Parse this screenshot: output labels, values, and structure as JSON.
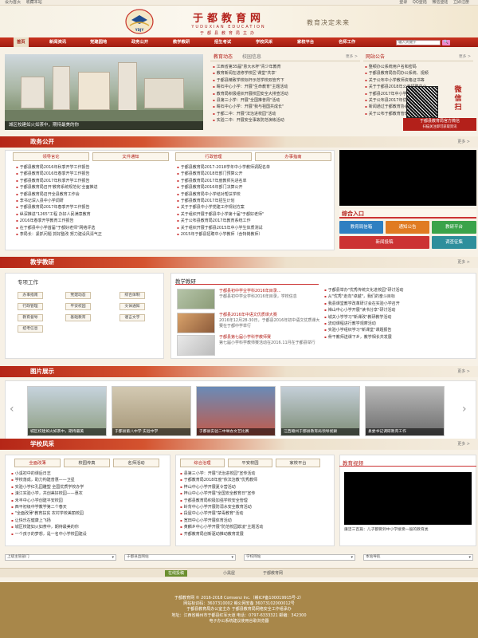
{
  "topbar": {
    "left": [
      "设为首页",
      "收藏本站"
    ],
    "right": [
      "登录",
      "QQ登陆",
      "微信登陆",
      "立即注册"
    ]
  },
  "header": {
    "brand": "于都教育网",
    "brand_en": "YUDUXIAN EDUCATION",
    "brand_sub": "于都县教育局主办",
    "logo_text": "YDJY",
    "slogan": "教育决定未来"
  },
  "nav": {
    "items": [
      "首页",
      "新闻资讯",
      "党建园地",
      "政务公开",
      "教学教研",
      "招生考试",
      "学校风采",
      "家校平台",
      "名师工作"
    ],
    "search_placeholder": "输入关键字",
    "search_btn": "🔍"
  },
  "banner": {
    "caption": "城区校建如火如荼中，期待最美的你"
  },
  "news": {
    "tabs": [
      "教育动态",
      "校园信息"
    ],
    "more": "更多 >",
    "items": [
      "江西省第35届\"意大水杯\"青少年教育",
      "教育新闻在进修学校区'课堂\"共享'",
      "于都县精致学校标杆示范学校双管齐下",
      "睛石中心小学：开展\"生命教育\"主题活动",
      "教育局积极组织开展校园安全大排查活动",
      "县第三小学：开展\"全国推普周\"活动",
      "睛石中心小学：开展\"我与祖国共成长\"",
      "于都二中：开展\"法治进校园\"活动",
      "实验二中：开展安全事故防范演练活动"
    ]
  },
  "notice": {
    "title": "网站公告",
    "more": "更多 >",
    "items": [
      "整顿办公系统用户名和密码",
      "于都县教育局协同办公系统、视频",
      "关于公布中小学教师资格证书等",
      "关于于都县2018年公开招聘中小",
      "于都县2017年中小学生营养餐",
      "关于公布县2017年优秀学生",
      "新闻通过于都教育协会",
      "关于公布于都教育管理考核"
    ],
    "qr_title": "于都县教育局官方微信",
    "qr_sub": "扫描关注即可获取资讯"
  },
  "gov": {
    "title": "政务公开",
    "more": "更多 >",
    "tabs": [
      "领导言论",
      "文件通知",
      "行政管理",
      "办事指南"
    ],
    "left": [
      "于都县教育局2016年秋季开学工作报告",
      "于都县教育局2016年春季开学工作报告",
      "于都县教育局2017年秋季开学工作报告",
      "于都县教育局召开'教育系统规范化'全面推进",
      "于都县教育局召开全县教育工作会",
      "李书记深入县中小学调研",
      "于都县教育局2017年春季开学工作报告",
      "纵深推进\"1265\"工程 办好人民满意教育",
      "2016年春季开学教育工作报告",
      "在于都县中小学首届\"于都好老师\"网络评选",
      "李局长：紧抓问题 抓好整改 努力建设风清气正"
    ],
    "right": [
      "于都县教育局2017-2018学年中小学教师调配名单",
      "于都县教育局2018年部门预算公开",
      "于都县教育局2017年度教师先进名单",
      "于都县教育局2016年部门决算公开",
      "于都县教育局中小学结对帮扶学校",
      "于都县教育局2017年招生计划",
      "关于于都县中小学党建工作规划方案",
      "关于组织开展于都县中小学第十届\"于都好老师\"",
      "关于公布县教育局2017年教育系统工作",
      "关于组织开展于都县2015年中小学生体质测试",
      "2015年于都县招聘中小学教师（含特岗教师）"
    ]
  },
  "quick": {
    "title": "综合入口",
    "btns": [
      "教育局信箱",
      "通知公告",
      "教研平台",
      "新闻投稿",
      "调查征集"
    ]
  },
  "research": {
    "title": "教学教研",
    "more": "更多 >",
    "work_title": "专项工作",
    "work_items": [
      "办事指南",
      "党建动态",
      "综合体制",
      "行政管理",
      "平安校园",
      "文体通知",
      "教育督导",
      "基础教育",
      "语言文字",
      "招考信息"
    ],
    "sub_title": "教学教研",
    "featured": [
      {
        "title": "于都县初中学业学科2016年目录...",
        "desc": "于都县初中学业学科2016年目录，学校信息"
      },
      {
        "title": "于都县2016年中语文优质课大赛",
        "desc": "2016年12月28-30日，于都县2016年初中语文优质课大赛在于都中学举行"
      },
      {
        "title": "于都县第七届小学科学教师赛",
        "desc": "第七届小学科学教师赛活动在2016.11月在于都县举行"
      }
    ],
    "list": [
      "于都县举办\"优秀传统文化进校园\"研讨活动",
      "从\"优秀\"走向\"卓越\"，我们的奋斗目标",
      "我县课堂教学改革研讨会在实验小学召开",
      "禅山中心小学开展\"读书分享\"研讨活动",
      "城关小学学习\"新课改\"教研教学活动",
      "流动课程进行教学观摩活动",
      "实验小学组织学习\"新课堂\"课题报告",
      "骨干教师送课下乡，教学相长共发展"
    ]
  },
  "photos": {
    "title": "图片展示",
    "more": "更多 >",
    "captions": [
      "城区校建如火如荼中，期待最美",
      "于都县第八中学 实验中学",
      "于都县实验二中举办文艺比赛",
      "江西赣州于都县教育局领导视察",
      "县委书记调研教育工作"
    ]
  },
  "school": {
    "title": "学校风采",
    "more": "更多 >",
    "tabs1": [
      "全面改薄",
      "校园传真",
      "名师活动"
    ],
    "list1": [
      "小溪初中的课后日志",
      "学校落成，助力构建普惠——卫星",
      "实验小学红孔园雕塑 全国优质学校办学",
      "濠江实验小学，共创美好校园——惠农",
      "禾丰中心小学创建平安校园",
      "西平初级中学教学第二个春天",
      "\"全面改薄\"教育扶贫 农村学校美丽校园",
      "让快乐在健康上飞扬",
      "城区校建如火如荼中，期待最美的你",
      "一个孩子的梦想，是一名中小学校园建设"
    ],
    "tabs2": [
      "综合治理",
      "平安校园",
      "家校平台"
    ],
    "list2": [
      "县第三小学：开展\"法治进校园\"宣传活动",
      "于都教育局2018年度\"依法治教\"优秀教师",
      "梓山中心小学开展夏令营活动",
      "梓山中心小学开展\"全国安全教育日\"宣传",
      "于都县教育局积极加强学校安全管理",
      "岭背中心小学开展防溺水安全教育活动",
      "段屋中心小学开展\"禁毒教育\"活动",
      "宽田中心小学开展体育活动",
      "黄麟乡中心小学开展\"防范校园欺凌\"主题活动",
      "齐都教育局创新驱动推动教育发展"
    ],
    "video_title": "教育视频",
    "video_caption": "廉洁三百篇：儿子都要到中小学接受一般的教育类"
  },
  "selects": [
    "上级主管部门",
    "于都县直网站",
    "学校网站",
    "本站导航"
  ],
  "footnav": [
    "在线投稿",
    "小黑屋",
    "于都教育网"
  ],
  "footer": [
    "于都教育网 © 2016-2018 Comsenz Inc.（赣ICP备100019915号-2）",
    "网站标识码：3607310002  赣公网安备 36073102000012号",
    "于都县教育局办公室主办 于都县教育局网络安全工作组承办",
    "地址：江西省赣州市于都县红军大道  电话：0797-6333321  邮编：342300",
    "电子办公系统建议使用谷歌浏览器"
  ]
}
